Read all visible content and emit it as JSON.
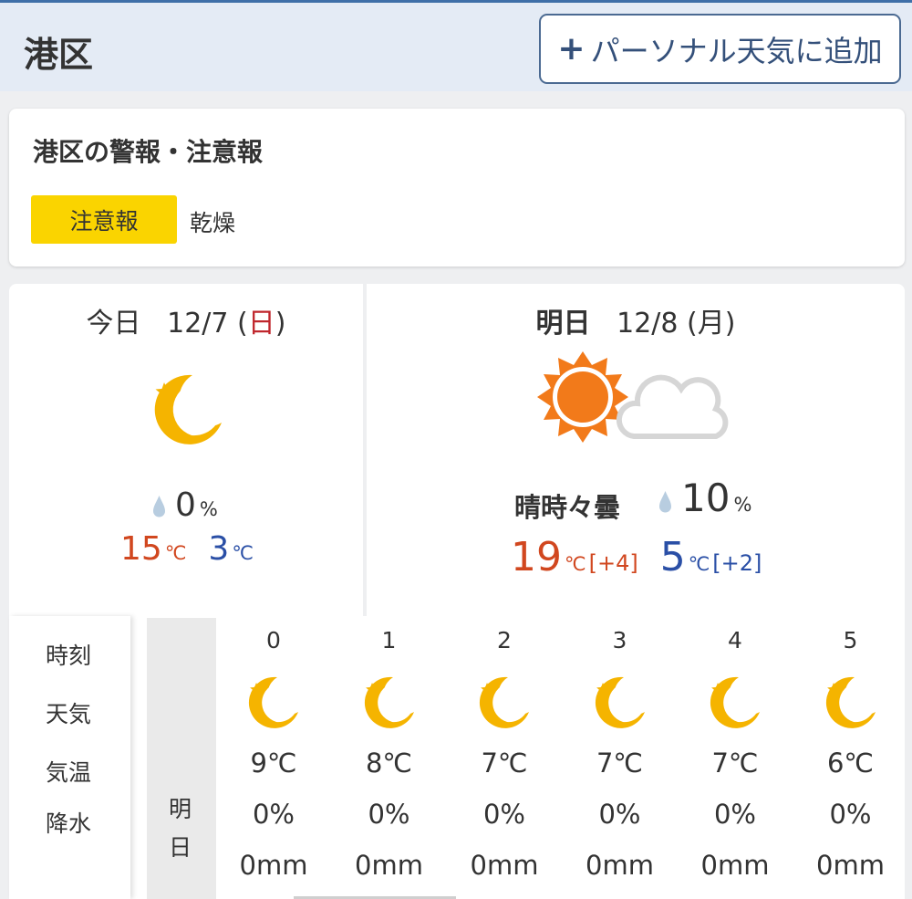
{
  "header": {
    "title": "港区",
    "add_button": "パーソナル天気に追加"
  },
  "warnings": {
    "title": "港区の警報・注意報",
    "badge": "注意報",
    "item": "乾燥"
  },
  "today": {
    "label": "今日",
    "date": "12/7",
    "paren_open": "(",
    "dow": "日",
    "paren_close": ")",
    "icon": "moon-icon",
    "pop": "0",
    "pop_unit": "%",
    "high": "15",
    "low": "3",
    "unit": "℃"
  },
  "tomorrow": {
    "label": "明日",
    "date": "12/8",
    "dow": "(月)",
    "icon": "sun-cloud-icon",
    "telop": "晴時々曇",
    "pop": "10",
    "pop_unit": "%",
    "high": "19",
    "high_diff": "[+4]",
    "low": "5",
    "low_diff": "[+2]",
    "unit": "℃"
  },
  "hourly": {
    "row_labels": [
      "時刻",
      "天気",
      "気温",
      "降水"
    ],
    "day_label": [
      "明",
      "日"
    ],
    "hours": [
      {
        "hour": "0",
        "icon": "moon-icon",
        "temp": "9℃",
        "pop": "0%",
        "precip": "0mm"
      },
      {
        "hour": "1",
        "icon": "moon-icon",
        "temp": "8℃",
        "pop": "0%",
        "precip": "0mm"
      },
      {
        "hour": "2",
        "icon": "moon-icon",
        "temp": "7℃",
        "pop": "0%",
        "precip": "0mm"
      },
      {
        "hour": "3",
        "icon": "moon-icon",
        "temp": "7℃",
        "pop": "0%",
        "precip": "0mm"
      },
      {
        "hour": "4",
        "icon": "moon-icon",
        "temp": "7℃",
        "pop": "0%",
        "precip": "0mm"
      },
      {
        "hour": "5",
        "icon": "moon-icon",
        "temp": "6℃",
        "pop": "0%",
        "precip": "0mm"
      }
    ]
  },
  "colors": {
    "accent": "#34507a",
    "high": "#d1471f",
    "low": "#2a4fa6",
    "badge": "#fad400",
    "moon": "#f5b400",
    "sun": "#f27a1a"
  }
}
